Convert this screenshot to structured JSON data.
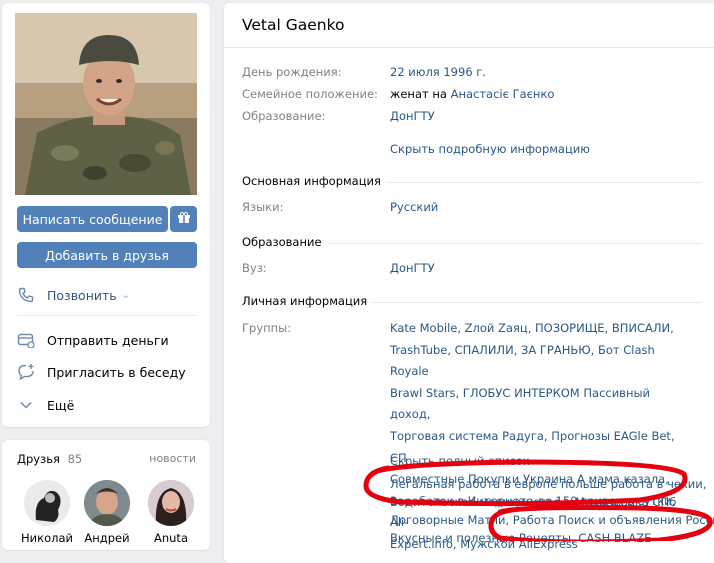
{
  "profile": {
    "name": "Vetal Gaenko",
    "buttons": {
      "message": "Написать сообщение",
      "add_friend": "Добавить в друзья"
    },
    "actions": {
      "call": "Позвонить",
      "send_money": "Отправить деньги",
      "invite": "Пригласить в беседу",
      "more": "Ещё"
    }
  },
  "info": {
    "birthday_label": "День рождения:",
    "birthday_value": "22 июля 1996 г.",
    "family_label": "Семейное положение:",
    "family_prefix": "женат на",
    "family_link": "Анастасіє Гаєнко",
    "education_label": "Образование:",
    "education_value": "ДонГТУ",
    "hide_link": "Скрыть подробную информацию",
    "main_section": "Основная информация",
    "languages_label": "Языки:",
    "languages_value": "Русский",
    "education_section": "Образование",
    "university_label": "Вуз:",
    "university_value": "ДонГТУ",
    "personal_section": "Личная информация",
    "groups_label": "Группы:",
    "groups_lines": [
      "Kate Mobile, Zлой Zаяц, ПОЗОРИЩЕ, ВПИСАЛИ,",
      "TrashTube, СПАЛИЛИ, ЗА ГРАНЬЮ, Бот Clash Royale",
      "Brawl Stars, ГЛОБУС ИНТЕРКОМ Пассивный доход,",
      "Торговая система Радуга, Прогнозы EAGle Bet, СП",
      "Совместные Покупки Украина А мама казала,",
      "Заработок в Интернете до 150 гривен в сутки, Ali-",
      "Expert.info, Мужской AliExpress"
    ],
    "show_full_list": "Скрыть полный список",
    "extra_lines": [
      "Легальная работа в европе польше работа в чехии,",
      "Водительская медицинская... Медсправка СПб",
      "Договорные Матчи, Работа Поиск и объявления Россия,",
      "Вкусные и полезные Рецепты, CASH BLAZE"
    ]
  },
  "friends": {
    "title": "Друзья",
    "count": "85",
    "news": "новости",
    "items": [
      {
        "name": "Николай"
      },
      {
        "name": "Андрей"
      },
      {
        "name": "Anuta"
      }
    ]
  },
  "colors": {
    "accent": "#5181b8",
    "link": "#2a5885",
    "label": "#828282",
    "annotation": "#e3000f"
  }
}
